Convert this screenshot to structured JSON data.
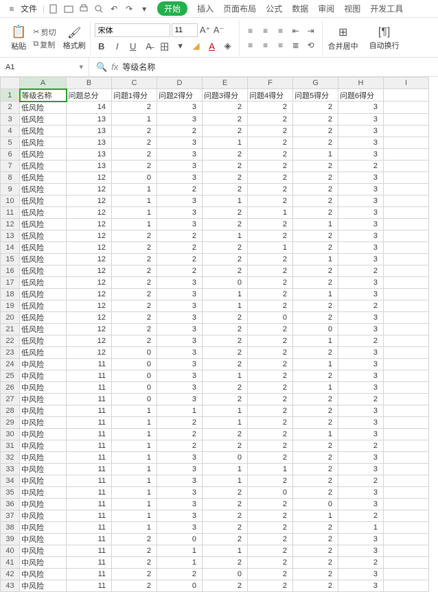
{
  "menubar": {
    "file": "文件"
  },
  "tabs": {
    "start": "开始",
    "insert": "插入",
    "layout": "页面布局",
    "formula": "公式",
    "data": "数据",
    "review": "审阅",
    "view": "视图",
    "dev": "开发工具"
  },
  "ribbon": {
    "paste": "粘贴",
    "cut": "剪切",
    "copy": "复制",
    "brush": "格式刷",
    "font_name": "宋体",
    "font_size": "11",
    "merge": "合并居中",
    "wrap": "自动换行"
  },
  "namebox": {
    "ref": "A1"
  },
  "formula_bar": {
    "value": "等级名称"
  },
  "columns": [
    "A",
    "B",
    "C",
    "D",
    "E",
    "F",
    "G",
    "H",
    "I"
  ],
  "chart_data": {
    "type": "table",
    "headers": [
      "等级名称",
      "问题总分",
      "问题1得分",
      "问题2得分",
      "问题3得分",
      "问题4得分",
      "问题5得分",
      "问题6得分"
    ],
    "rows": [
      [
        "低风险",
        14,
        2,
        3,
        2,
        2,
        2,
        3
      ],
      [
        "低风险",
        13,
        1,
        3,
        2,
        2,
        2,
        3
      ],
      [
        "低风险",
        13,
        2,
        2,
        2,
        2,
        2,
        3
      ],
      [
        "低风险",
        13,
        2,
        3,
        1,
        2,
        2,
        3
      ],
      [
        "低风险",
        13,
        2,
        3,
        2,
        2,
        1,
        3
      ],
      [
        "低风险",
        13,
        2,
        3,
        2,
        2,
        2,
        2
      ],
      [
        "低风险",
        12,
        0,
        3,
        2,
        2,
        2,
        3
      ],
      [
        "低风险",
        12,
        1,
        2,
        2,
        2,
        2,
        3
      ],
      [
        "低风险",
        12,
        1,
        3,
        1,
        2,
        2,
        3
      ],
      [
        "低风险",
        12,
        1,
        3,
        2,
        1,
        2,
        3
      ],
      [
        "低风险",
        12,
        1,
        3,
        2,
        2,
        1,
        3
      ],
      [
        "低风险",
        12,
        2,
        2,
        1,
        2,
        2,
        3
      ],
      [
        "低风险",
        12,
        2,
        2,
        2,
        1,
        2,
        3
      ],
      [
        "低风险",
        12,
        2,
        2,
        2,
        2,
        1,
        3
      ],
      [
        "低风险",
        12,
        2,
        2,
        2,
        2,
        2,
        2
      ],
      [
        "低风险",
        12,
        2,
        3,
        0,
        2,
        2,
        3
      ],
      [
        "低风险",
        12,
        2,
        3,
        1,
        2,
        1,
        3
      ],
      [
        "低风险",
        12,
        2,
        3,
        1,
        2,
        2,
        2
      ],
      [
        "低风险",
        12,
        2,
        3,
        2,
        0,
        2,
        3
      ],
      [
        "低风险",
        12,
        2,
        3,
        2,
        2,
        0,
        3
      ],
      [
        "低风险",
        12,
        2,
        3,
        2,
        2,
        1,
        2
      ],
      [
        "低风险",
        12,
        0,
        3,
        2,
        2,
        2,
        3
      ],
      [
        "中风险",
        11,
        0,
        3,
        2,
        2,
        1,
        3
      ],
      [
        "中风险",
        11,
        0,
        3,
        1,
        2,
        2,
        3
      ],
      [
        "中风险",
        11,
        0,
        3,
        2,
        2,
        1,
        3
      ],
      [
        "中风险",
        11,
        0,
        3,
        2,
        2,
        2,
        2
      ],
      [
        "中风险",
        11,
        1,
        1,
        1,
        2,
        2,
        3
      ],
      [
        "中风险",
        11,
        1,
        2,
        1,
        2,
        2,
        3
      ],
      [
        "中风险",
        11,
        1,
        2,
        2,
        2,
        1,
        3
      ],
      [
        "中风险",
        11,
        1,
        2,
        2,
        2,
        2,
        2
      ],
      [
        "中风险",
        11,
        1,
        3,
        0,
        2,
        2,
        3
      ],
      [
        "中风险",
        11,
        1,
        3,
        1,
        1,
        2,
        3
      ],
      [
        "中风险",
        11,
        1,
        3,
        1,
        2,
        2,
        2
      ],
      [
        "中风险",
        11,
        1,
        3,
        2,
        0,
        2,
        3
      ],
      [
        "中风险",
        11,
        1,
        3,
        2,
        2,
        0,
        3
      ],
      [
        "中风险",
        11,
        1,
        3,
        2,
        2,
        1,
        2
      ],
      [
        "中风险",
        11,
        1,
        3,
        2,
        2,
        2,
        1
      ],
      [
        "中风险",
        11,
        2,
        0,
        2,
        2,
        2,
        3
      ],
      [
        "中风险",
        11,
        2,
        1,
        1,
        2,
        2,
        3
      ],
      [
        "中风险",
        11,
        2,
        1,
        2,
        2,
        2,
        2
      ],
      [
        "中风险",
        11,
        2,
        2,
        0,
        2,
        2,
        3
      ],
      [
        "中风险",
        11,
        2,
        0,
        2,
        2,
        2,
        3
      ]
    ]
  }
}
